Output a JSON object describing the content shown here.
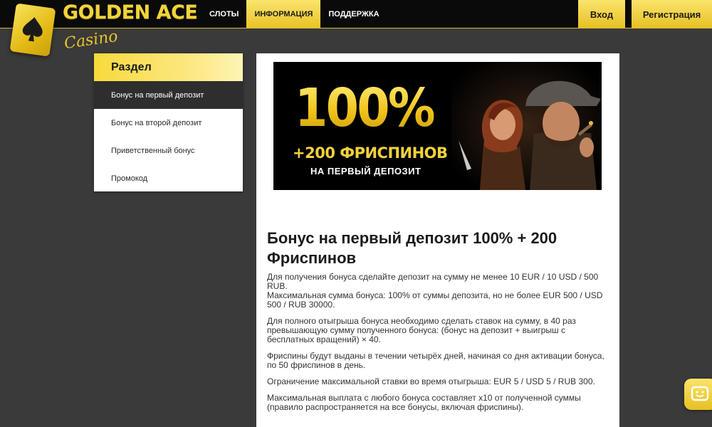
{
  "brand": {
    "name": "GOLDEN ACE",
    "sub": "Casino"
  },
  "nav": [
    {
      "label": "СЛОТЫ",
      "active": false
    },
    {
      "label": "ИНФОРМАЦИЯ",
      "active": true
    },
    {
      "label": "ПОДДЕРЖКА",
      "active": false
    }
  ],
  "header_buttons": {
    "login": "Вход",
    "register": "Регистрация"
  },
  "sidebar": {
    "title": "Раздел",
    "items": [
      {
        "label": "Бонус на первый депозит",
        "active": true
      },
      {
        "label": "Бонус на второй депозит",
        "active": false
      },
      {
        "label": "Приветственный бонус",
        "active": false
      },
      {
        "label": "Промокод",
        "active": false
      }
    ]
  },
  "banner": {
    "big": "100%",
    "mid": "+200 ФРИСПИНОВ",
    "small": "НА ПЕРВЫЙ ДЕПОЗИТ"
  },
  "article": {
    "title": "Бонус на первый депозит 100% + 200 Фриспинов",
    "paragraphs": [
      "Для получения бонуса сделайте депозит на сумму не менее 10 EUR / 10 USD / 500 RUB.",
      "Максимальная сумма бонуса: 100% от суммы депозита, но не более EUR 500 / USD 500 / RUB 30000.",
      "Для полного отыгрыша бонуса необходимо сделать ставок на сумму, в 40 раз превышающую сумму полученного бонуса: (бонус на депозит + выигрыш с бесплатных вращений) × 40.",
      "Фриспины будут выданы в течении четырёх дней, начиная со дня активации бонуса, по 50 фриспинов в день.",
      "Ограничение максимальной ставки во время отыгрыша: EUR 5 / USD 5 / RUB 300.",
      "Максимальная выплата с любого бонуса составляет x10 от полученной суммы (правило распространяется на все бонусы, включая фриспины)."
    ]
  },
  "icons": {
    "logo": "spade-card-icon",
    "chat": "smiley-chat-icon"
  },
  "colors": {
    "accent": "#f3cf2a",
    "header_bg": "#0a0a0a",
    "page_bg": "#3a3a3a"
  }
}
